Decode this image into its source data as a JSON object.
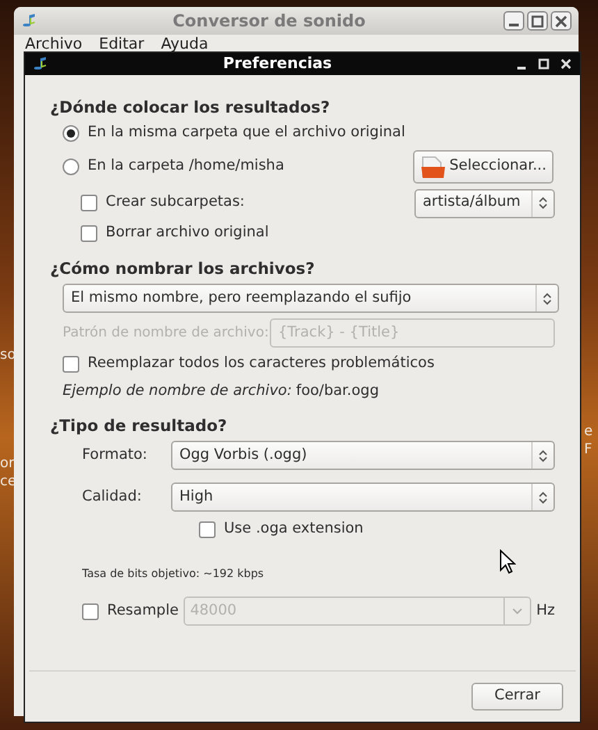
{
  "main_window": {
    "title": "Conversor de sonido",
    "menu": [
      "Archivo",
      "Editar",
      "Ayuda"
    ]
  },
  "left_background_fragments": [
    "so",
    "or",
    "ce"
  ],
  "right_background_fragments": [
    "e",
    "F"
  ],
  "dialog": {
    "title": "Preferencias",
    "output_location": {
      "heading": "¿Dónde colocar los resultados?",
      "options": [
        {
          "label": "En la misma carpeta que el archivo original",
          "selected": true
        },
        {
          "label": "En la carpeta /home/misha",
          "selected": false
        }
      ],
      "select_button": "Seleccionar...",
      "create_subfolders": {
        "label": "Crear subcarpetas:",
        "checked": false
      },
      "subfolder_pattern": "artista/álbum",
      "delete_original": {
        "label": "Borrar archivo original",
        "checked": false
      }
    },
    "naming": {
      "heading": "¿Cómo nombrar los archivos?",
      "scheme": "El mismo nombre, pero reemplazando el sufijo",
      "pattern_label": "Patrón de nombre de archivo:",
      "pattern_value": "{Track} - {Title}",
      "pattern_disabled": true,
      "replace_chars": {
        "label": "Reemplazar todos los caracteres problemáticos",
        "checked": false
      },
      "example_label": "Ejemplo de nombre de archivo:",
      "example_value": "foo/bar.ogg"
    },
    "output_type": {
      "heading": "¿Tipo de resultado?",
      "format_label": "Formato:",
      "format": "Ogg Vorbis (.ogg)",
      "quality_label": "Calidad:",
      "quality": "High",
      "oga": {
        "label": "Use .oga extension",
        "checked": false
      },
      "bitrate": "Tasa de bits objetivo: ~192 kbps",
      "resample": {
        "label": "Resample",
        "checked": false
      },
      "rate": "48000",
      "rate_unit": "Hz"
    },
    "close_button": "Cerrar"
  }
}
